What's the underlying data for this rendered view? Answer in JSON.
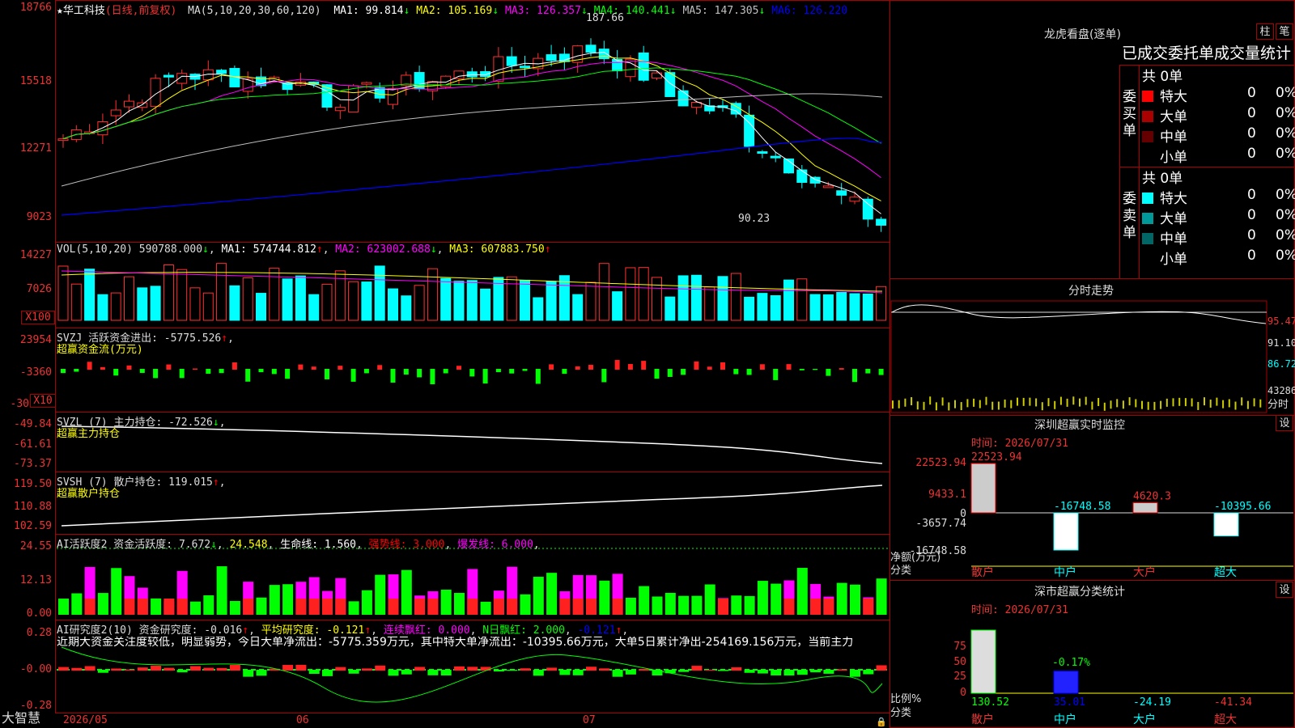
{
  "stock": {
    "star": "★",
    "name": "华工科技",
    "mode": "(日线,前复权)"
  },
  "ma_header": {
    "params": "MA(5,10,20,30,60,120)",
    "items": [
      {
        "label": "MA1: 99.814",
        "arrow": "↓",
        "color": "#ffffff"
      },
      {
        "label": "MA2: 105.169",
        "arrow": "↓",
        "color": "#ffff00"
      },
      {
        "label": "MA3: 126.357",
        "arrow": "↓",
        "color": "#ff00ff"
      },
      {
        "label": "MA4: 140.441",
        "arrow": "↓",
        "color": "#00ff00"
      },
      {
        "label": "MA5: 147.305",
        "arrow": "↓",
        "color": "#c0c0c0"
      },
      {
        "label": "MA6: 126.220",
        "arrow": "",
        "color": "#0000ff"
      }
    ]
  },
  "price_axis": [
    "18766",
    "15518",
    "12271",
    "9023"
  ],
  "price_annotations": {
    "high": "187.66",
    "low": "90.23"
  },
  "vol_header": {
    "params": "VOL(5,10,20)",
    "value": "590788.000",
    "v_arrow": "↓",
    "ma1": "MA1: 574744.812",
    "ma1_arrow": "↑",
    "ma2": "MA2: 623002.688",
    "ma2_arrow": "↓",
    "ma3": "MA3: 607883.750",
    "ma3_arrow": "↑"
  },
  "vol_axis": [
    "14227",
    "7026",
    "X100"
  ],
  "svzj": {
    "header": "SVZJ  活跃资金进出: -5775.526",
    "arrow": "↑",
    "sub": "超赢资金流(万元)",
    "axis": [
      "23954",
      "-3360",
      "-30",
      "X10"
    ]
  },
  "svzl": {
    "header": "SVZL (7) 主力持仓: -72.526",
    "arrow": "↓",
    "sub": "超赢主力持仓",
    "axis": [
      "-49.84",
      "-61.61",
      "-73.37"
    ]
  },
  "svsh": {
    "header": "SVSH (7) 散户持仓: 119.015",
    "arrow": "↑",
    "sub": "超赢散户持仓",
    "axis": [
      "119.50",
      "110.88",
      "102.59"
    ]
  },
  "ai1": {
    "header": "AI活跃度2 资金活跃度: 7.672",
    "arrow1": "↓",
    "v2": "24.548",
    "life": "生命线: 1.560",
    "strong": "强势线: 3.000",
    "burst": "爆发线: 6.000",
    "axis": [
      "24.55",
      "12.13",
      "0.00"
    ]
  },
  "ai2": {
    "header": "AI研究度2(10) 资金研究度: -0.016",
    "a1": "↑",
    "avg": "平均研究度: -0.121",
    "a2": "↑",
    "red": "连续飘红: 0.000",
    "nred": "N日飘红: 2.000",
    "nval": "-0.121",
    "a3": "↑",
    "text": "近期大资金关注度较低，明显弱势，今日大单净流出：-5775.359万元，其中特大单净流出：-10395.66万元，大单5日累计净出-254169.156万元，当前主力",
    "axis": [
      "0.28",
      "-0.00",
      "-0.28"
    ]
  },
  "bottom": {
    "logo": "大智慧",
    "d1": "2026/05",
    "d2": "06",
    "d3": "07"
  },
  "right": {
    "lhb_title": "龙虎看盘(逐单)",
    "btn1": "柱",
    "btn2": "笔",
    "tabs": "已成交委托单成交量统计",
    "buy_label": "委买单",
    "sell_label": "委卖单",
    "buy": {
      "total": "共 0单",
      "rows": [
        {
          "name": "特大",
          "n": "0",
          "p": "0%",
          "color": "#ff0000"
        },
        {
          "name": "大单",
          "n": "0",
          "p": "0%",
          "color": "#aa0000"
        },
        {
          "name": "中单",
          "n": "0",
          "p": "0%",
          "color": "#660000"
        },
        {
          "name": "小单",
          "n": "0",
          "p": "0%",
          "color": "#000000"
        }
      ]
    },
    "sell": {
      "total": "共 0单",
      "rows": [
        {
          "name": "特大",
          "n": "0",
          "p": "0%",
          "color": "#00ffff"
        },
        {
          "name": "大单",
          "n": "0",
          "p": "0%",
          "color": "#009999"
        },
        {
          "name": "中单",
          "n": "0",
          "p": "0%",
          "color": "#006666"
        },
        {
          "name": "小单",
          "n": "0",
          "p": "0%",
          "color": "#000000"
        }
      ]
    },
    "fs_title": "分时走势",
    "fs_axis": [
      "95.47",
      "91.10",
      "86.72",
      "43286",
      "分时"
    ],
    "monitor_title": "深圳超赢实时监控",
    "monitor_btn": "设",
    "monitor_time": "时间: 2026/07/31",
    "monitor_axis": [
      "22523.94",
      "9433.1",
      "0",
      "-3657.74",
      "-16748.58"
    ],
    "monitor_bottom": "净额(万元)",
    "monitor_cat": "分类",
    "stat_title": "深市超赢分类统计",
    "stat_btn": "设",
    "stat_time": "时间: 2026/07/31",
    "stat_axis": [
      "75",
      "50",
      "25",
      "0"
    ],
    "stat_bottom": "比例%",
    "stat_cat": "分类"
  },
  "chart_data": [
    {
      "type": "bar",
      "title": "深圳超赢实时监控",
      "categories": [
        "散户",
        "中户",
        "大户",
        "超大"
      ],
      "values": [
        22523.94,
        -16748.58,
        4620.3,
        -10395.66
      ],
      "ylim": [
        -16748.58,
        22523.94
      ],
      "ylabel": "净额(万元)",
      "xlabel": "分类"
    },
    {
      "type": "bar",
      "title": "深市超赢分类统计",
      "categories": [
        "散户",
        "中户",
        "大户",
        "超大"
      ],
      "values": [
        130.52,
        35.01,
        -24.19,
        -41.34
      ],
      "annotation": "-0.17%",
      "ylabel": "比例%",
      "xlabel": "分类"
    }
  ]
}
